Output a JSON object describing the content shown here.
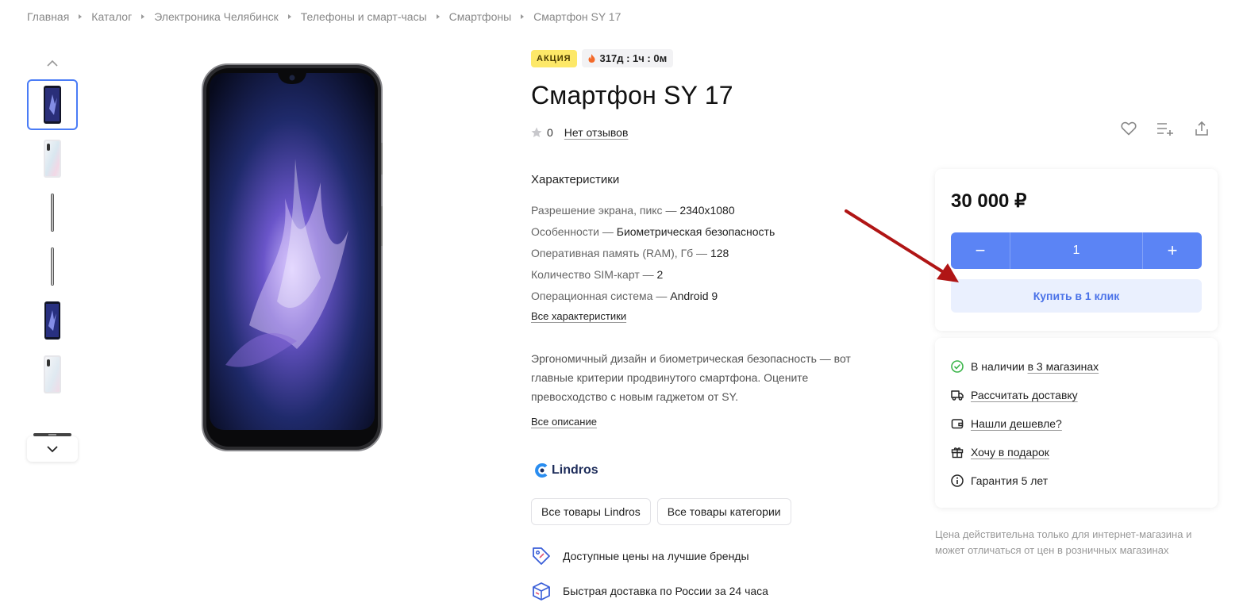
{
  "breadcrumb": [
    "Главная",
    "Каталог",
    "Электроника Челябинск",
    "Телефоны и смарт-часы",
    "Смартфоны",
    "Смартфон SY 17"
  ],
  "badges": {
    "sale": "АКЦИЯ",
    "timer": "317д : 1ч : 0м"
  },
  "product": {
    "title": "Смартфон SY 17",
    "rating": "0",
    "reviews": "Нет отзывов"
  },
  "specs": {
    "heading": "Характеристики",
    "items": [
      {
        "label": "Разрешение экрана, пикс — ",
        "value": "2340x1080"
      },
      {
        "label": "Особенности — ",
        "value": "Биометрическая безопасность"
      },
      {
        "label": "Оперативная память (RAM), Гб — ",
        "value": "128"
      },
      {
        "label": "Количество SIM-карт — ",
        "value": "2"
      },
      {
        "label": "Операционная система — ",
        "value": "Android 9"
      }
    ],
    "all_link": "Все характеристики"
  },
  "description": {
    "text": "Эргономичный дизайн и биометрическая безопасность — вот главные критерии продвинутого смартфона. Оцените превосходство с новым гаджетом от SY.",
    "all_link": "Все описание"
  },
  "brand": {
    "name": "Lindros",
    "btn_all_brand": "Все товары Lindros",
    "btn_all_category": "Все товары категории"
  },
  "features": [
    "Доступные цены на лучшие бренды",
    "Быстрая доставка по России за 24 часа"
  ],
  "purchase": {
    "price": "30 000 ₽",
    "quantity": "1",
    "minus": "−",
    "plus": "+",
    "buy_one_click": "Купить в 1 клик"
  },
  "info": {
    "stock_prefix": "В наличии ",
    "stock_link": "в 3 магазинах",
    "delivery": "Рассчитать доставку",
    "cheaper": "Нашли дешевле?",
    "gift": "Хочу в подарок",
    "warranty": "Гарантия 5 лет"
  },
  "note": "Цена действительна только для интернет-магазина и может отличаться от цен в розничных магазинах",
  "colors": {
    "accent": "#5b84f5",
    "sale": "#fde868",
    "annotation": "#b01515"
  }
}
